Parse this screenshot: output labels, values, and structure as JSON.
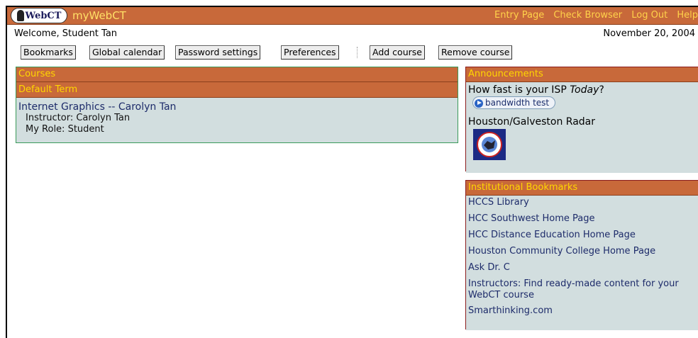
{
  "header": {
    "logo_text": "WebCT",
    "brand": "myWebCT",
    "links": [
      "Entry Page",
      "Check Browser",
      "Log Out",
      "Help"
    ]
  },
  "welcome": "Welcome, Student Tan",
  "date": "November 20, 2004",
  "toolbar": {
    "bookmarks": "Bookmarks",
    "global_calendar": "Global calendar",
    "password_settings": "Password settings",
    "preferences": "Preferences",
    "add_course": "Add course",
    "remove_course": "Remove course"
  },
  "courses": {
    "title": "Courses",
    "term": "Default Term",
    "course_name": "Internet Graphics -- Carolyn Tan",
    "instructor": "Instructor: Carolyn Tan",
    "role": "My Role: Student"
  },
  "announcements": {
    "title": "Announcements",
    "isp_prefix": "How fast is your ISP ",
    "isp_italic": "Today",
    "isp_suffix": "?",
    "bandwidth_button": "bandwidth test",
    "radar_title": "Houston/Galveston Radar"
  },
  "institutional": {
    "title": "Institutional Bookmarks",
    "items": [
      "HCCS Library",
      "HCC Southwest Home Page",
      "HCC Distance Education Home Page",
      "Houston Community College Home Page",
      "Ask Dr. C",
      "Instructors: Find ready-made content for your WebCT course",
      "Smarthinking.com"
    ]
  },
  "colors": {
    "header_bg": "#c8693a",
    "header_link": "#ffd24a",
    "panel_body": "#d2dedf",
    "link": "#1d2b6a"
  }
}
